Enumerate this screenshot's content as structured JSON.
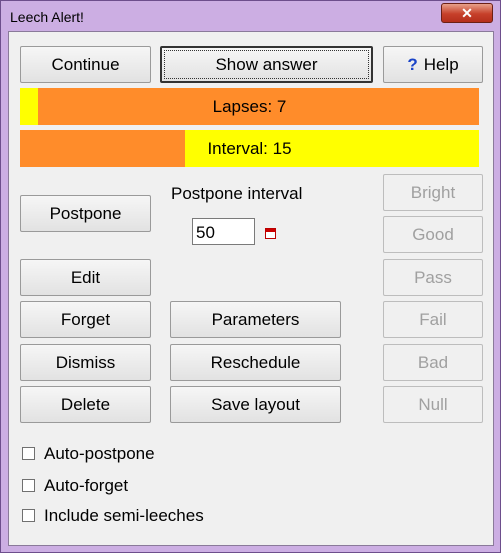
{
  "window": {
    "title": "Leech Alert!",
    "close_glyph": "✕"
  },
  "top_buttons": {
    "continue": "Continue",
    "show_answer": "Show answer",
    "help": "Help",
    "help_icon_glyph": "?"
  },
  "bars": [
    {
      "label": "Lapses: 7",
      "fill_fraction": 0.04,
      "bg_color": "#ff8c2a",
      "fill_color": "#ffff00"
    },
    {
      "label": "Interval: 15",
      "fill_fraction": 0.36,
      "bg_color": "#ffff00",
      "fill_color": "#ff8c2a"
    }
  ],
  "postpone": {
    "button": "Postpone",
    "interval_label": "Postpone interval",
    "interval_value": "50"
  },
  "middle_buttons": {
    "edit": "Edit",
    "forget": "Forget",
    "dismiss": "Dismiss",
    "delete": "Delete",
    "parameters": "Parameters",
    "reschedule": "Reschedule",
    "save_layout": "Save layout"
  },
  "grade_buttons": [
    "Bright",
    "Good",
    "Pass",
    "Fail",
    "Bad",
    "Null"
  ],
  "checkboxes": [
    {
      "label": "Auto-postpone",
      "checked": false
    },
    {
      "label": "Auto-forget",
      "checked": false
    },
    {
      "label": "Include semi-leeches",
      "checked": false
    }
  ],
  "colors": {
    "title_bar": "#ccaee3",
    "client_bg": "#f0f0f0",
    "close_button": "#c6402a",
    "help_icon": "#1a44c8"
  }
}
